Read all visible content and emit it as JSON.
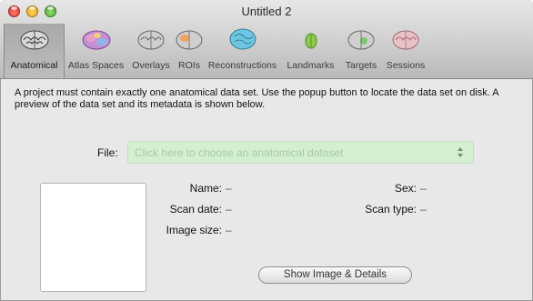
{
  "window": {
    "title": "Untitled 2"
  },
  "tabs": [
    {
      "label": "Anatomical",
      "icon": "brain-anatomical-icon",
      "selected": true
    },
    {
      "label": "Atlas Spaces",
      "icon": "brain-atlas-icon",
      "selected": false
    },
    {
      "label": "Overlays",
      "icon": "brain-overlays-icon",
      "selected": false
    },
    {
      "label": "ROIs",
      "icon": "brain-rois-icon",
      "selected": false
    },
    {
      "label": "Reconstructions",
      "icon": "brain-reconstructions-icon",
      "selected": false
    },
    {
      "label": "Landmarks",
      "icon": "brain-landmarks-icon",
      "selected": false
    },
    {
      "label": "Targets",
      "icon": "brain-targets-icon",
      "selected": false
    },
    {
      "label": "Sessions",
      "icon": "brain-sessions-icon",
      "selected": false
    }
  ],
  "content": {
    "description": "A project must contain exactly one anatomical data set. Use the popup button to locate the data set on disk. A preview of the data set and its metadata is shown below.",
    "file_label": "File:",
    "file_placeholder": "Click here to choose an anatomical dataset",
    "metadata": {
      "name_label": "Name:",
      "name_value": "–",
      "scan_date_label": "Scan date:",
      "scan_date_value": "–",
      "image_size_label": "Image size:",
      "image_size_value": "–",
      "sex_label": "Sex:",
      "sex_value": "–",
      "scan_type_label": "Scan type:",
      "scan_type_value": "–"
    },
    "details_button": "Show Image & Details"
  },
  "colors": {
    "file_field_bg": "#d4eed2",
    "file_placeholder": "#a7caa5"
  }
}
